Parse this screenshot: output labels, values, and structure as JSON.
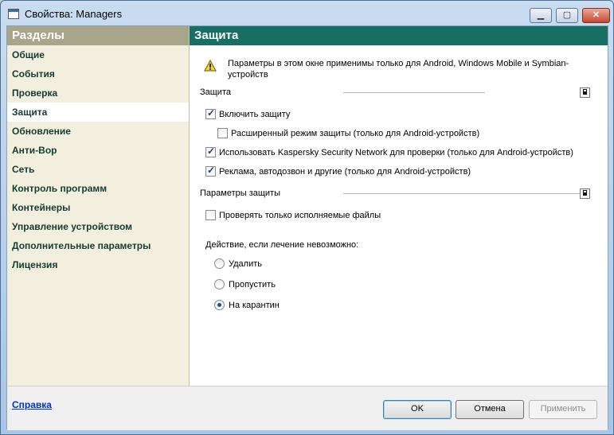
{
  "window": {
    "title": "Свойства: Managers",
    "min_glyph": "▁",
    "max_glyph": "▢",
    "close_glyph": "✕"
  },
  "sidebar": {
    "header": "Разделы",
    "items": [
      {
        "label": "Общие"
      },
      {
        "label": "События"
      },
      {
        "label": "Проверка"
      },
      {
        "label": "Защита",
        "active": true
      },
      {
        "label": "Обновление"
      },
      {
        "label": "Анти-Вор"
      },
      {
        "label": "Сеть"
      },
      {
        "label": "Контроль программ"
      },
      {
        "label": "Контейнеры"
      },
      {
        "label": "Управление устройством"
      },
      {
        "label": "Дополнительные параметры"
      },
      {
        "label": "Лицензия"
      }
    ]
  },
  "main": {
    "header": "Защита",
    "warning": {
      "icon": "warning-icon",
      "text": "Параметры в этом окне применимы только для Android, Windows Mobile и Symbian-устройств"
    },
    "protection_group": {
      "title": "Защита",
      "enable_protection": {
        "label": "Включить защиту",
        "checked": true
      },
      "extended_mode": {
        "label": "Расширенный режим защиты (только для Android-устройств)",
        "checked": false
      },
      "ksn": {
        "label": "Использовать Kaspersky Security Network для проверки (только для Android-устройств)",
        "checked": true
      },
      "adware": {
        "label": "Реклама, автодозвон и другие (только для Android-устройств)",
        "checked": true
      }
    },
    "params_group": {
      "title": "Параметры защиты",
      "exec_only": {
        "label": "Проверять только исполняемые файлы",
        "checked": false
      },
      "action_label": "Действие, если лечение невозможно:",
      "actions": [
        {
          "label": "Удалить",
          "selected": false
        },
        {
          "label": "Пропустить",
          "selected": false
        },
        {
          "label": "На карантин",
          "selected": true
        }
      ]
    }
  },
  "footer": {
    "help": "Справка",
    "ok": "OK",
    "cancel": "Отмена",
    "apply": "Применить"
  },
  "colors": {
    "main_header": "#176e63",
    "sidebar_header": "#a9a58a",
    "sidebar_bg": "#f3efde",
    "nav_text": "#143c32"
  }
}
